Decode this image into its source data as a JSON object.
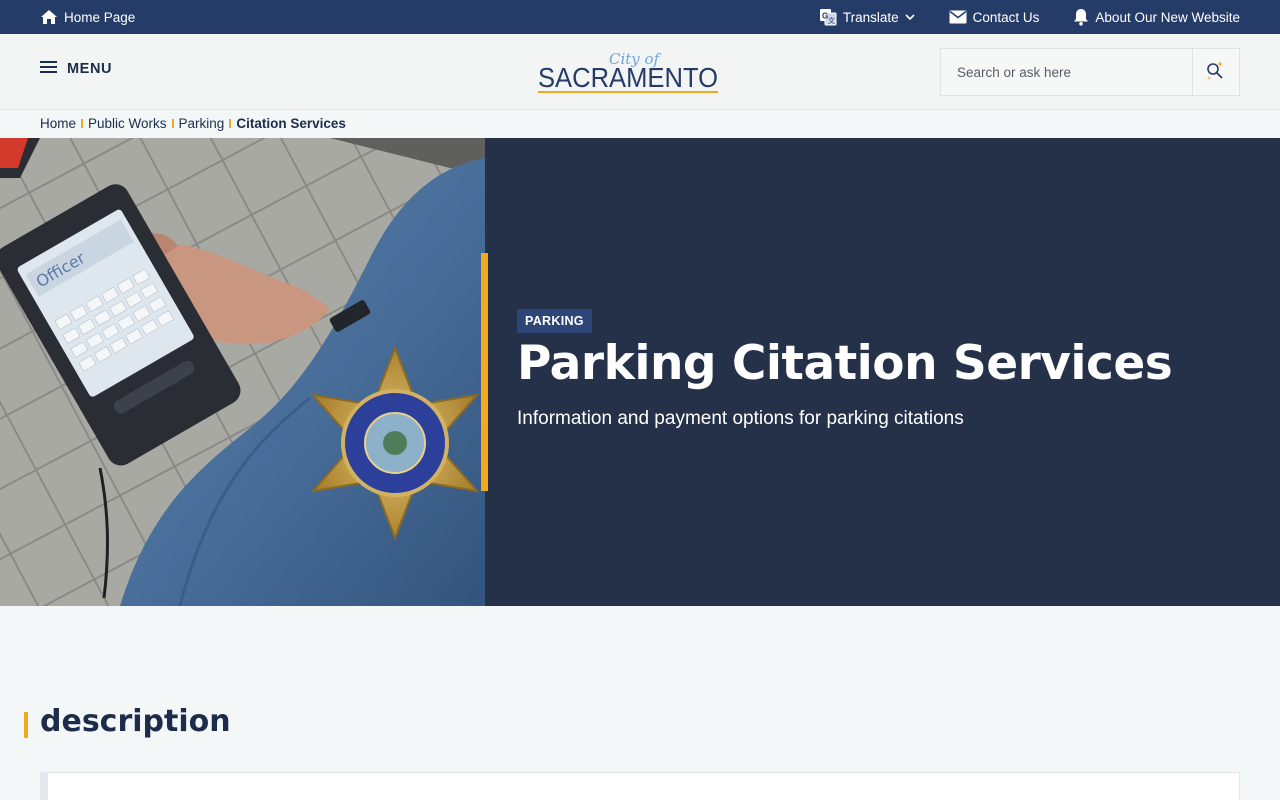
{
  "utility": {
    "home_label": "Home Page",
    "translate_label": "Translate",
    "contact_label": "Contact Us",
    "about_label": "About Our New Website",
    "icons": [
      "home-icon",
      "translate-icon",
      "chevron-down-icon",
      "mail-icon",
      "bell-icon"
    ]
  },
  "header": {
    "menu_label": "MENU",
    "logo": {
      "script_text": "City of",
      "main_text": "SACRAMENTO"
    },
    "search_placeholder": "Search or ask here"
  },
  "breadcrumb": {
    "items": [
      "Home",
      "Public Works",
      "Parking"
    ],
    "current": "Citation Services"
  },
  "hero": {
    "tag": "PARKING",
    "title": "Parking Citation Services",
    "subtitle": "Information and payment options for parking citations"
  },
  "section": {
    "title": "description"
  },
  "colors": {
    "top_bar": "#263c68",
    "hero_bg": "#243149",
    "accent": "#f2a91c",
    "tag_bg": "#2d4577",
    "text_dark": "#1c2c4a"
  }
}
